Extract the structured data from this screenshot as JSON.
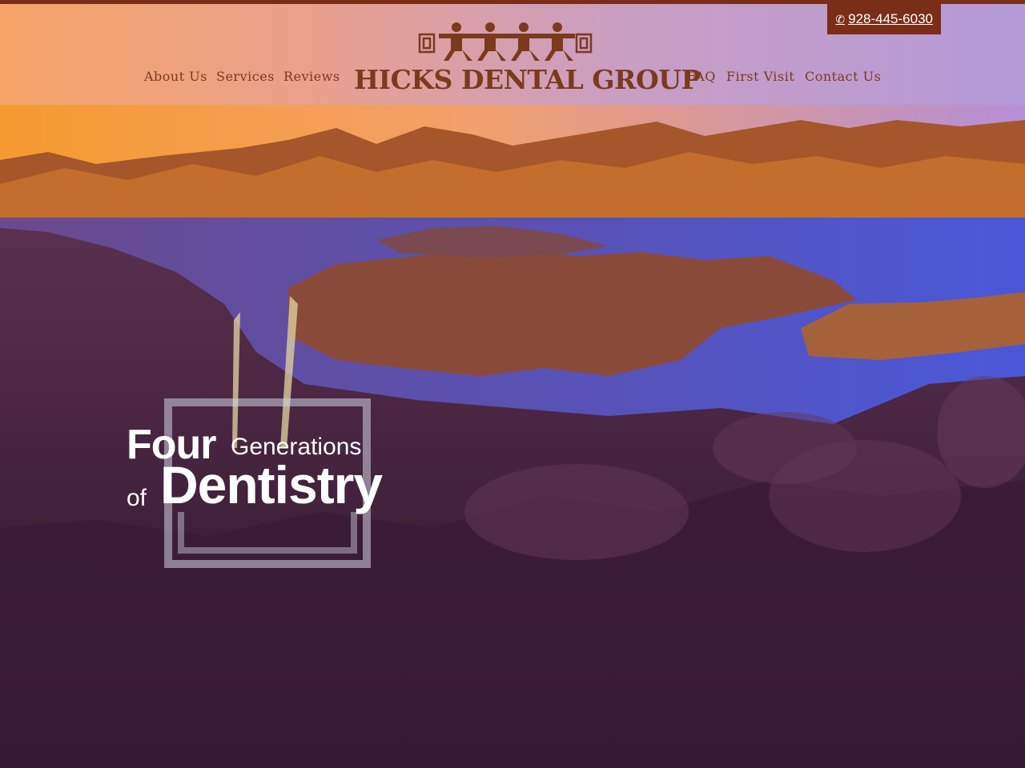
{
  "header": {
    "phone": "928-445-6030",
    "phone_icon": "phone-icon",
    "brand": "HICKS DENTAL GROUP",
    "logo_icon": "dancing-figures-logo-icon",
    "nav_left": [
      {
        "label": "About Us"
      },
      {
        "label": "Services"
      },
      {
        "label": "Reviews"
      }
    ],
    "nav_right": [
      {
        "label": "FAQ"
      },
      {
        "label": "First Visit"
      },
      {
        "label": "Contact Us"
      }
    ]
  },
  "hero": {
    "line1_big": "Four",
    "line1_small": "Generations",
    "line2_small": "of",
    "line2_big": "Dentistry"
  },
  "colors": {
    "brand": "#7a2e18",
    "nav_text": "#7b3a1e",
    "tagline_text": "#ffffff"
  }
}
